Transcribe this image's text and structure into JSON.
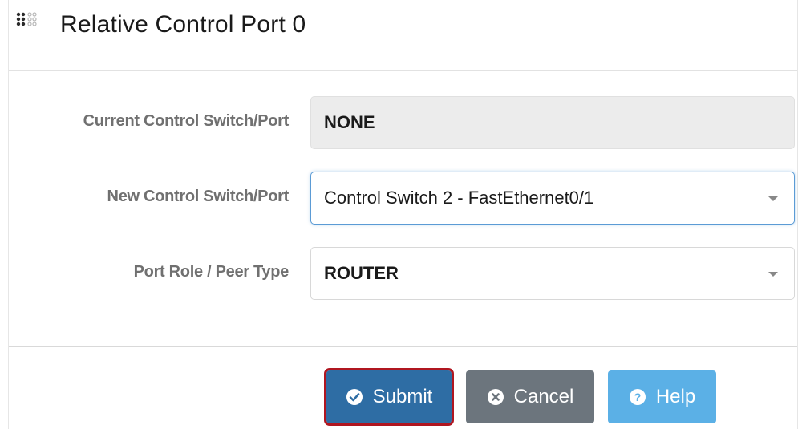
{
  "header": {
    "title": "Relative Control Port 0",
    "icon": "grip-icon"
  },
  "form": {
    "current": {
      "label": "Current Control Switch/Port",
      "value": "NONE"
    },
    "new": {
      "label": "New Control Switch/Port",
      "value": "Control Switch 2 - FastEthernet0/1"
    },
    "role": {
      "label": "Port Role / Peer Type",
      "value": "ROUTER"
    }
  },
  "buttons": {
    "submit": {
      "label": "Submit",
      "icon": "check-circle-icon"
    },
    "cancel": {
      "label": "Cancel",
      "icon": "x-circle-icon"
    },
    "help": {
      "label": "Help",
      "icon": "question-circle-icon"
    }
  },
  "colors": {
    "submit_bg": "#2e6da4",
    "submit_outline": "#b01620",
    "cancel_bg": "#6c757d",
    "help_bg": "#5bb0e6",
    "focus_border": "#5b9bd5"
  }
}
